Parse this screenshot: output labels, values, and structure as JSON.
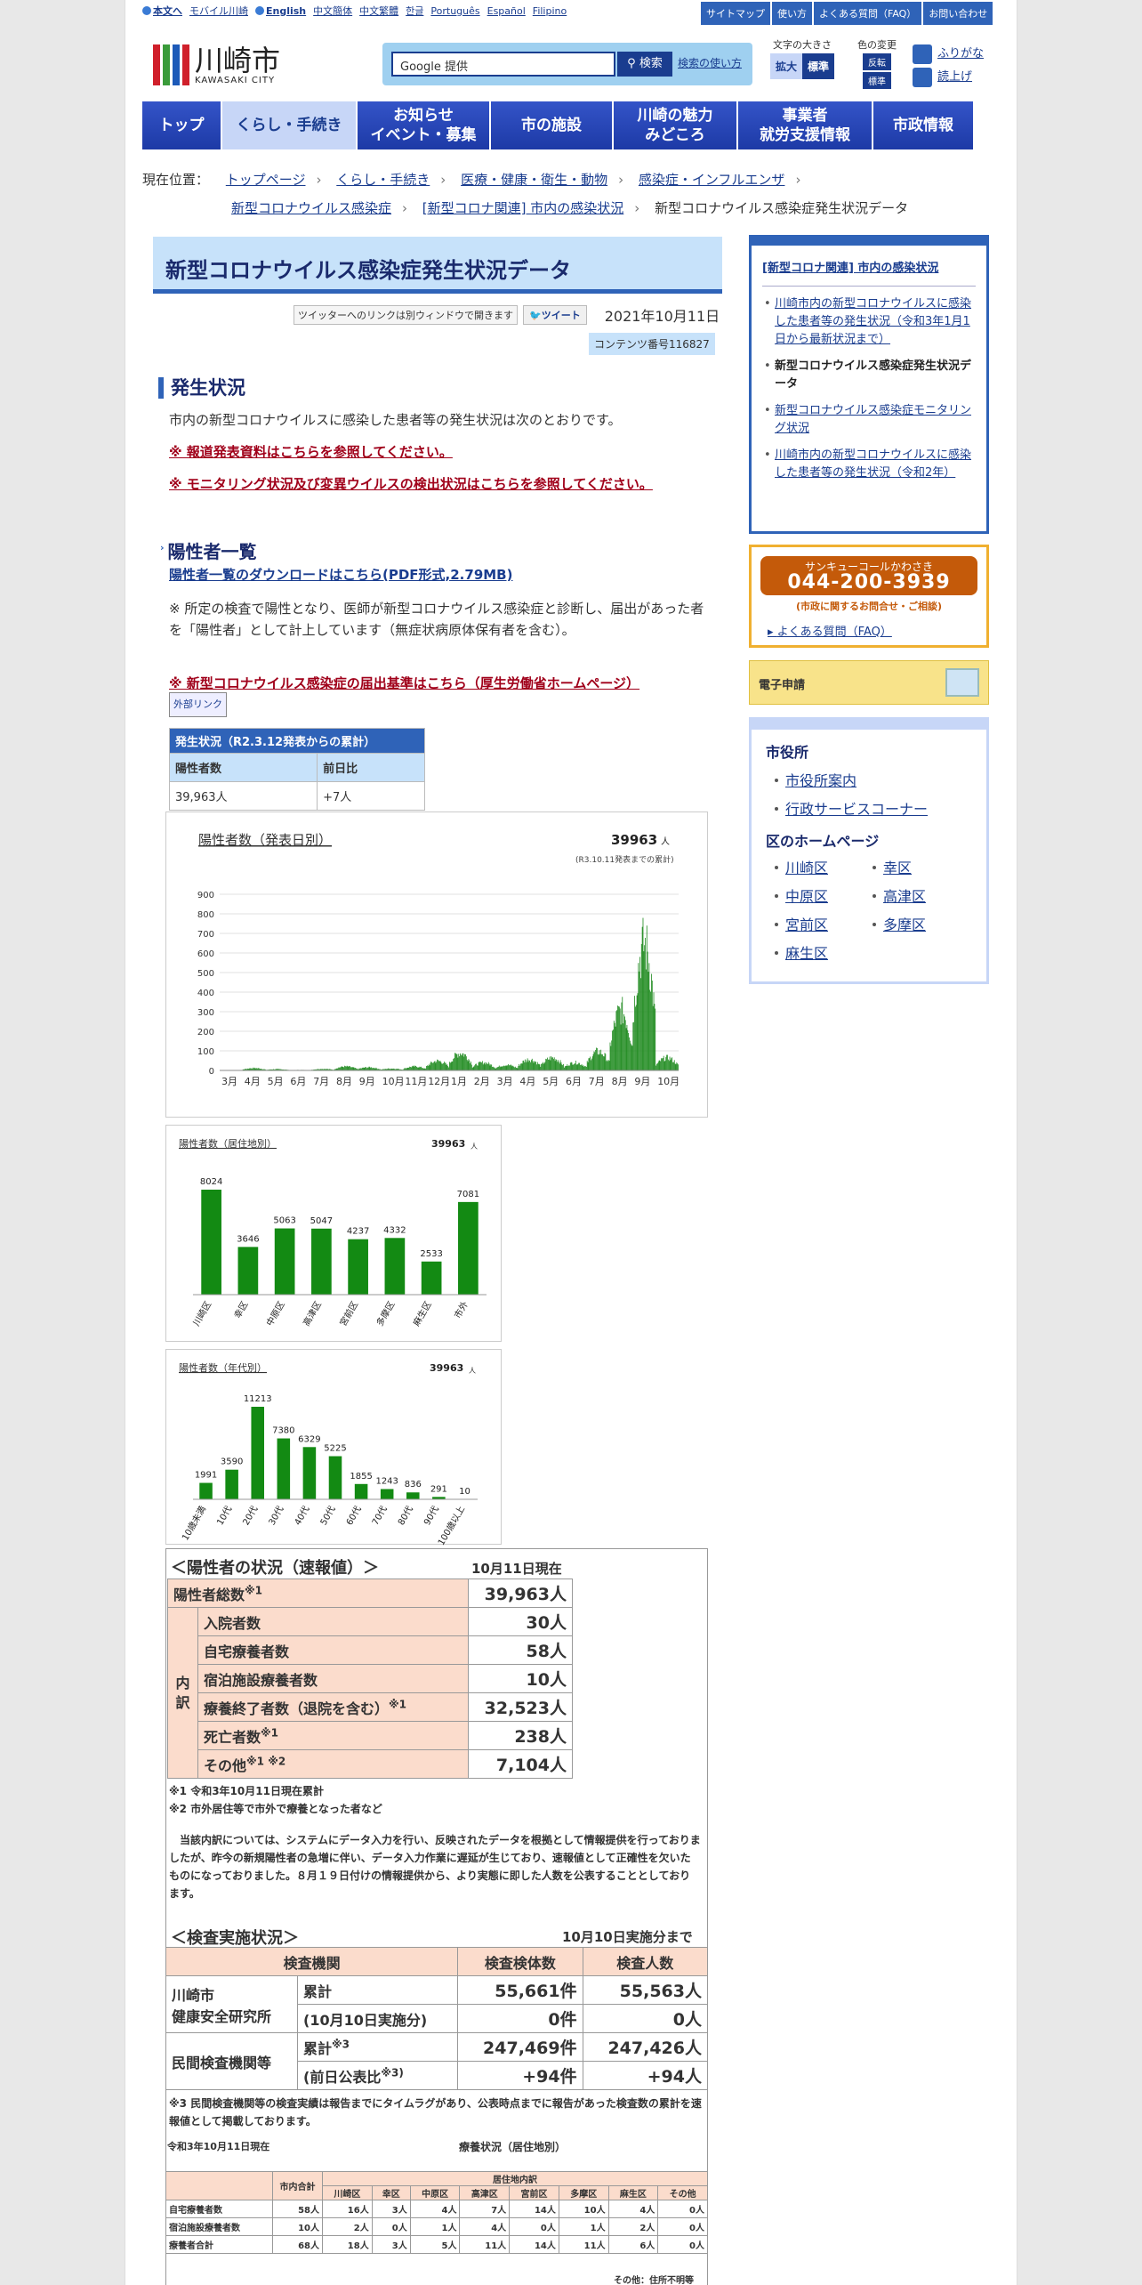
{
  "util": {
    "links": [
      "本文へ",
      "モバイル川崎",
      "English",
      "中文簡体",
      "中文繁體",
      "한글",
      "Português",
      "Español",
      "Filipino"
    ],
    "top": [
      "サイトマップ",
      "使い方",
      "よくある質問（FAQ）",
      "お問い合わせ"
    ]
  },
  "logo": {
    "name": "川崎市",
    "en": "KAWASAKI CITY",
    "colors": [
      "#d0202b",
      "#3a9b3a",
      "#1d5ab8"
    ]
  },
  "search": {
    "placeholder": "Google 提供",
    "button": "検索",
    "how": "検索の使い方"
  },
  "fontsize": {
    "label": "文字の大きさ",
    "large": "拡大",
    "normal": "標準"
  },
  "color": {
    "label": "色の変更",
    "inv": "反転",
    "std": "標準"
  },
  "furi": {
    "a": "ふりがな",
    "b": "読上げ"
  },
  "gnav": [
    "トップ",
    "くらし・手続き",
    "お知らせ\nイベント・募集",
    "市の施設",
    "川崎の魅力\nみどころ",
    "事業者\n就労支援情報",
    "市政情報"
  ],
  "crumb": {
    "label": "現在位置：",
    "items": [
      "トップページ",
      "くらし・手続き",
      "医療・健康・衛生・動物",
      "感染症・インフルエンザ",
      "新型コロナウイルス感染症",
      "[新型コロナ関連] 市内の感染状況"
    ],
    "current": "新型コロナウイルス感染症発生状況データ"
  },
  "title": "新型コロナウイルス感染症発生状況データ",
  "tweet": {
    "note": "ツイッターへのリンクは別ウィンドウで開きます",
    "btn": "ツイート",
    "date": "2021年10月11日",
    "content": "コンテンツ番号116827"
  },
  "sec1": {
    "h": "発生状況",
    "p": "市内の新型コロナウイルスに感染した患者等の発生状況は次のとおりです。",
    "r1": "※ 報道発表資料はこちらを参照してください。",
    "r2": "※ モニタリング状況及び変異ウイルスの検出状況はこちらを参照してください。"
  },
  "sec2": {
    "h": "陽性者一覧",
    "dl": "陽性者一覧のダウンロードはこちら(PDF形式,2.79MB)",
    "note": "※ 所定の検査で陽性となり、医師が新型コロナウイルス感染症と診断し、届出があった者を「陽性者」として計上しています（無症状病原体保有者を含む）。",
    "r3": "※ 新型コロナウイルス感染症の届出基準はこちら（厚生労働省ホームページ）",
    "ext": "外部リンク"
  },
  "stat": {
    "head": "発生状況（R2.3.12発表からの累計）",
    "c1": "陽性者数",
    "c2": "前日比",
    "v1": "39,963人",
    "v2": "+7人"
  },
  "chart_data": [
    {
      "type": "bar",
      "title": "陽性者数（発表日別）",
      "total": "39963",
      "unit": "人",
      "note": "(R3.10.11発表までの累計)",
      "yticks": [
        0,
        100,
        200,
        300,
        400,
        500,
        600,
        700,
        800,
        900
      ],
      "ylim": [
        0,
        900
      ],
      "categories": [
        "3月",
        "4月",
        "5月",
        "6月",
        "7月",
        "8月",
        "9月",
        "10月",
        "11月",
        "12月",
        "1月",
        "2月",
        "3月",
        "4月",
        "5月",
        "6月",
        "7月",
        "8月",
        "9月",
        "10月"
      ],
      "monthly_peak": [
        2,
        15,
        8,
        3,
        10,
        25,
        20,
        12,
        25,
        60,
        110,
        50,
        35,
        70,
        80,
        50,
        120,
        380,
        800,
        80
      ]
    },
    {
      "type": "bar",
      "title": "陽性者数（居住地別）",
      "total": "39963",
      "unit": "人",
      "categories": [
        "川崎区",
        "幸区",
        "中原区",
        "高津区",
        "宮前区",
        "多摩区",
        "麻生区",
        "市外"
      ],
      "values": [
        8024,
        3646,
        5063,
        5047,
        4237,
        4332,
        2533,
        7081
      ]
    },
    {
      "type": "bar",
      "title": "陽性者数（年代別）",
      "total": "39963",
      "unit": "人",
      "categories": [
        "10歳未満",
        "10代",
        "20代",
        "30代",
        "40代",
        "50代",
        "60代",
        "70代",
        "80代",
        "90代",
        "100歳以上"
      ],
      "values": [
        1991,
        3590,
        11213,
        7380,
        6329,
        5225,
        1855,
        1243,
        836,
        291,
        10
      ]
    }
  ],
  "pos": {
    "title": "＜陽性者の状況（速報値）＞",
    "date": "10月11日現在",
    "rows": [
      [
        "陽性者総数",
        "※1",
        "39,963人"
      ],
      [
        "入院者数",
        "",
        "30人"
      ],
      [
        "自宅療養者数",
        "",
        "58人"
      ],
      [
        "宿泊施設療養者数",
        "",
        "10人"
      ],
      [
        "療養終了者数（退院を含む）",
        "※1",
        "32,523人"
      ],
      [
        "死亡者数",
        "※1",
        "238人"
      ],
      [
        "その他",
        "※1 ※2",
        "7,104人"
      ]
    ],
    "side": "内\n訳",
    "n1": "※1 令和3年10月11日現在累計",
    "n2": "※2 市外居住等で市外で療養となった者など",
    "para": "当該内訳については、システムにデータ入力を行い、反映されたデータを根拠として情報提供を行っておりましたが、昨今の新規陽性者の急増に伴い、データ入力作業に遅延が生じており、速報値として正確性を欠いたものになっておりました。８月１９日付けの情報提供から、より実態に即した人数を公表することとしております。"
  },
  "test": {
    "title": "＜検査実施状況＞",
    "date": "10月10日実施分まで",
    "h": [
      "検査機関",
      "検査検体数",
      "検査人数"
    ],
    "org1": "川崎市\n健康安全研究所",
    "org2": "民間検査機関等",
    "r": [
      [
        "累計",
        "",
        "55,661件",
        "55,563人"
      ],
      [
        "(10月10日実施分)",
        "",
        "0件",
        "0人"
      ],
      [
        "累計",
        "※3",
        "247,469件",
        "247,426人"
      ],
      [
        "(前日公表比",
        "※3)",
        "+94件",
        "+94人"
      ]
    ],
    "n3": "※3 民間検査機関等の検査実績は報告までにタイムラグがあり、公表時点までに報告があった検査数の累計を速報値として掲載しております。"
  },
  "ryo": {
    "date": "令和3年10月11日現在",
    "title": "療養状況（居住地別）",
    "sub": "居住地内訳",
    "cols": [
      "市内合計",
      "川崎区",
      "幸区",
      "中原区",
      "高津区",
      "宮前区",
      "多摩区",
      "麻生区",
      "その他"
    ],
    "rows": [
      [
        "自宅療養者数",
        "58人",
        "16人",
        "3人",
        "4人",
        "7人",
        "14人",
        "10人",
        "4人",
        "0人"
      ],
      [
        "宿泊施設療養者数",
        "10人",
        "2人",
        "0人",
        "1人",
        "4人",
        "0人",
        "1人",
        "2人",
        "0人"
      ],
      [
        "療養者合計",
        "68人",
        "18人",
        "3人",
        "5人",
        "11人",
        "14人",
        "11人",
        "6人",
        "0人"
      ]
    ],
    "foot": "その他：住所不明等"
  },
  "side": {
    "ttl": "[新型コロナ関連] 市内の感染状況",
    "items": [
      "川崎市内の新型コロナウイルスに感染した患者等の発生状況（令和3年1月1日から最新状況まで）",
      "新型コロナウイルス感染症発生状況データ",
      "新型コロナウイルス感染症モニタリング状況",
      "川崎市内の新型コロナウイルスに感染した患者等の発生状況（令和2年）"
    ],
    "call": "サンキューコールかわさき",
    "tel": "044-200-3939",
    "callsub": "(市政に関するお問合せ・ご相談)",
    "faq": "よくある質問（FAQ）",
    "e": "電子申請",
    "cityh": "市役所",
    "city": [
      "市役所案内",
      "行政サービスコーナー"
    ],
    "wardh": "区のホームページ",
    "wards": [
      "川崎区",
      "幸区",
      "中原区",
      "高津区",
      "宮前区",
      "多摩区",
      "麻生区"
    ]
  }
}
